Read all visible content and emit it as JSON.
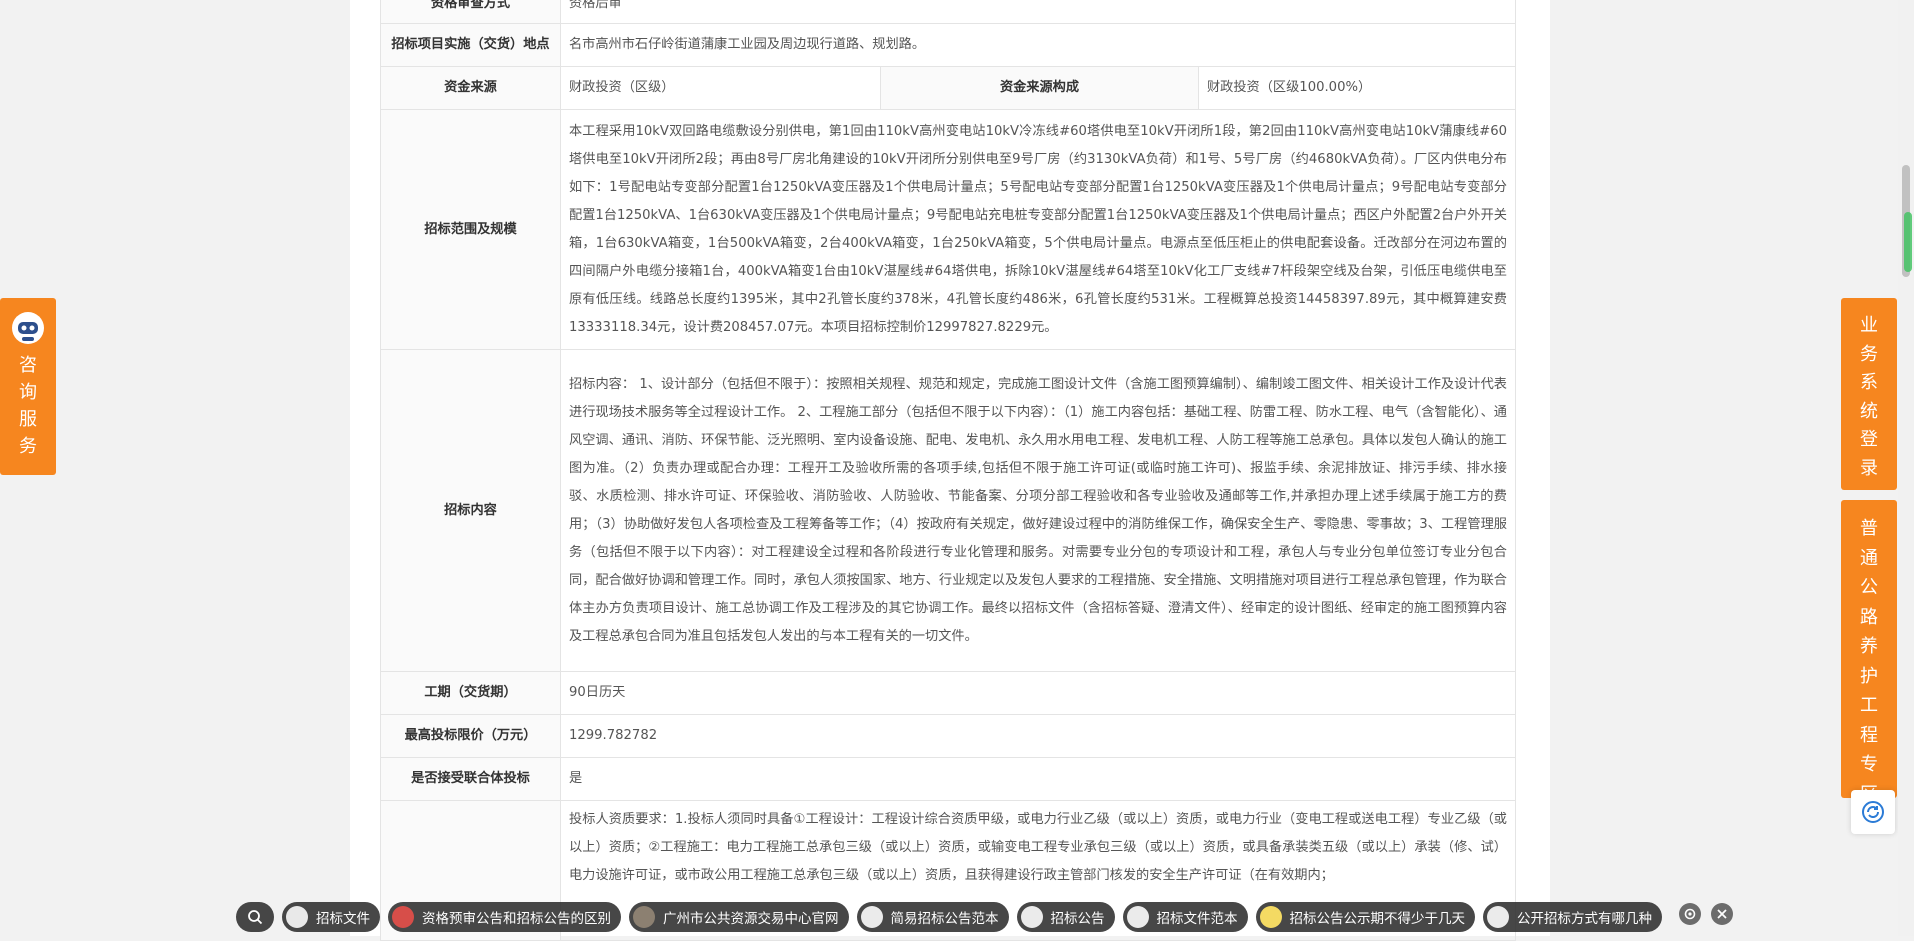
{
  "table": {
    "row0": {
      "label": "资格审查方式",
      "value": "资格后审"
    },
    "row1": {
      "label": "招标项目实施（交货）地点",
      "value": "名市高州市石仔岭街道蒲康工业园及周边现行道路、规划路。"
    },
    "row2": {
      "label": "资金来源",
      "value": "财政投资（区级）",
      "label2": "资金来源构成",
      "value2": "财政投资（区级100.00%）"
    },
    "row3": {
      "label": "招标范围及规模",
      "value": "本工程采用10kV双回路电缆敷设分别供电，第1回由110kV高州变电站10kV冷冻线#60塔供电至10kV开闭所1段，第2回由110kV高州变电站10kV蒲康线#60塔供电至10kV开闭所2段；再由8号厂房北角建设的10kV开闭所分别供电至9号厂房（约3130kVA负荷）和1号、5号厂房（约4680kVA负荷）。厂区内供电分布如下：1号配电站专变部分配置1台1250kVA变压器及1个供电局计量点；5号配电站专变部分配置1台1250kVA变压器及1个供电局计量点；9号配电站专变部分配置1台1250kVA、1台630kVA变压器及1个供电局计量点；9号配电站充电桩专变部分配置1台1250kVA变压器及1个供电局计量点；西区户外配置2台户外开关箱，1台630kVA箱变，1台500kVA箱变，2台400kVA箱变，1台250kVA箱变，5个供电局计量点。电源点至低压柜止的供电配套设备。迁改部分在河边布置的四间隔户外电缆分接箱1台，400kVA箱变1台由10kV湛屋线#64塔供电，拆除10kV湛屋线#64塔至10kV化工厂支线#7杆段架空线及台架，引低压电缆供电至原有低压线。线路总长度约1395米，其中2孔管长度约378米，4孔管长度约486米，6孔管长度约531米。工程概算总投资14458397.89元，其中概算建安费13333118.34元，设计费208457.07元。本项目招标控制价12997827.8229元。"
    },
    "row4": {
      "label": "招标内容",
      "value": "招标内容： 1、设计部分（包括但不限于）：按照相关规程、规范和规定，完成施工图设计文件（含施工图预算编制）、编制竣工图文件、相关设计工作及设计代表进行现场技术服务等全过程设计工作。 2、工程施工部分（包括但不限于以下内容）：（1）施工内容包括：基础工程、防雷工程、防水工程、电气（含智能化）、通风空调、通讯、消防、环保节能、泛光照明、室内设备设施、配电、发电机、永久用水用电工程、发电机工程、人防工程等施工总承包。具体以发包人确认的施工图为准。（2）负责办理或配合办理：工程开工及验收所需的各项手续,包括但不限于施工许可证(或临时施工许可)、报监手续、余泥排放证、排污手续、排水接驳、水质检测、排水许可证、环保验收、消防验收、人防验收、节能备案、分项分部工程验收和各专业验收及通邮等工作,并承担办理上述手续属于施工方的费用；（3）协助做好发包人各项检查及工程筹备等工作；（4）按政府有关规定，做好建设过程中的消防维保工作，确保安全生产、零隐患、零事故；3、工程管理服务（包括但不限于以下内容）：对工程建设全过程和各阶段进行专业化管理和服务。对需要专业分包的专项设计和工程，承包人与专业分包单位签订专业分包合同，配合做好协调和管理工作。同时，承包人须按国家、地方、行业规定以及发包人要求的工程措施、安全措施、文明措施对项目进行工程总承包管理，作为联合体主办方负责项目设计、施工总协调工作及工程涉及的其它协调工作。最终以招标文件（含招标答疑、澄清文件）、经审定的设计图纸、经审定的施工图预算内容及工程总承包合同为准且包括发包人发出的与本工程有关的一切文件。"
    },
    "row5": {
      "label": "工期（交货期）",
      "value": "90日历天"
    },
    "row6": {
      "label": "最高投标限价（万元）",
      "value": "1299.782782"
    },
    "row7": {
      "label": "是否接受联合体投标",
      "value": "是"
    },
    "row8": {
      "label": "",
      "value": "投标人资质要求：1.投标人须同时具备①工程设计：工程设计综合资质甲级，或电力行业乙级（或以上）资质，或电力行业（变电工程或送电工程）专业乙级（或以上）资质；②工程施工：电力工程施工总承包三级（或以上）资质，或输变电工程专业承包三级（或以上）资质，或具备承装类五级（或以上）承装（修、试）电力设施许可证，或市政公用工程施工总承包三级（或以上）资质，且获得建设行政主管部门核发的安全生产许可证（在有效期内；"
    }
  },
  "left_float": {
    "label": "咨询服务"
  },
  "right_float": {
    "login_label": "业务系统登录",
    "zone_label": "普通公路养护工程专区"
  },
  "bottom_bar": {
    "items": [
      {
        "label": "招标文件"
      },
      {
        "label": "资格预审公告和招标公告的区别"
      },
      {
        "label": "广州市公共资源交易中心官网"
      },
      {
        "label": "简易招标公告范本"
      },
      {
        "label": "招标公告"
      },
      {
        "label": "招标文件范本"
      },
      {
        "label": "招标公告公示期不得少于几天"
      },
      {
        "label": "公开招标方式有哪几种"
      }
    ]
  },
  "colors": {
    "accent": "#f6861f",
    "scroll_green": "#3cc25e"
  }
}
